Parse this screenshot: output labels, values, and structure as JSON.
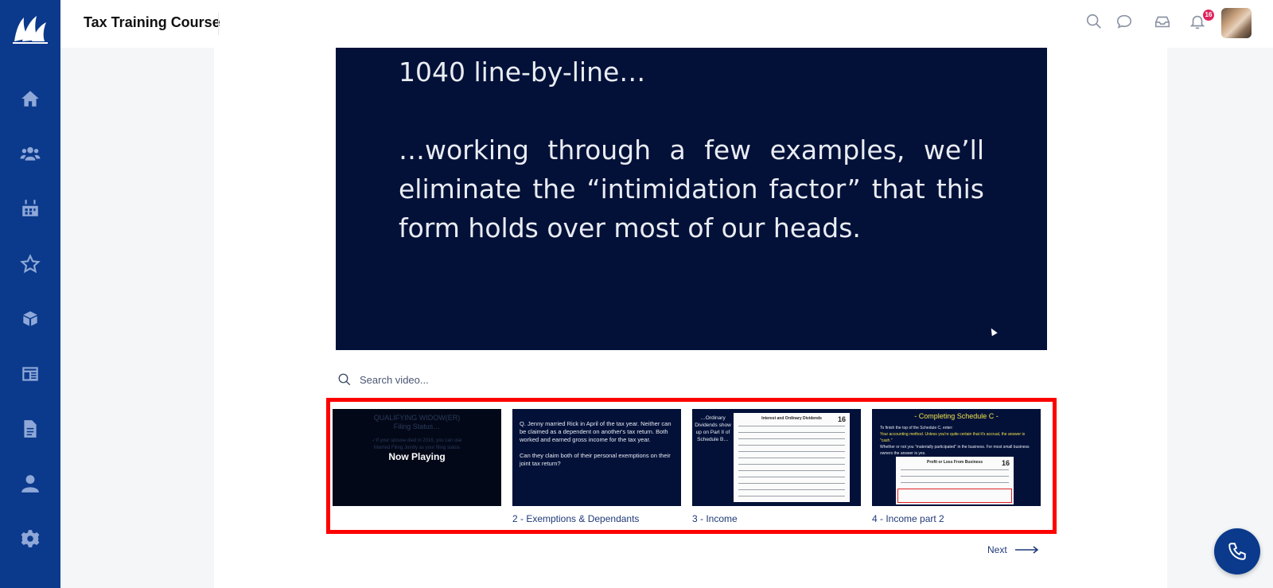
{
  "app": {
    "title": "Tax Training Course"
  },
  "header": {
    "notification_count": "16",
    "icons": [
      "search-icon",
      "chat-icon",
      "inbox-icon",
      "bell-icon",
      "avatar"
    ]
  },
  "sidebar": {
    "items": [
      {
        "icon": "home-icon"
      },
      {
        "icon": "users-icon"
      },
      {
        "icon": "calendar-icon"
      },
      {
        "icon": "star-icon"
      },
      {
        "icon": "box-icon"
      },
      {
        "icon": "newspaper-icon"
      },
      {
        "icon": "document-icon"
      },
      {
        "icon": "user-icon"
      },
      {
        "icon": "gear-icon"
      }
    ]
  },
  "video": {
    "line1": "1040 line-by-line…",
    "paragraph": "…working through a few examples, we’ll eliminate the “intimidation factor” that this form holds over most of our heads."
  },
  "search": {
    "placeholder": "Search video..."
  },
  "playlist": {
    "items": [
      {
        "label": "",
        "thumb_title_line1": "QUALIFYING WIDOW(ER)",
        "thumb_title_line2": "Filing Status…",
        "thumb_sub_line1": "✓If your spouse died in 2016, you can use",
        "thumb_sub_line2": "Married Filing Jointly as your filing status",
        "status": "Now Playing"
      },
      {
        "label": "2 - Exemptions & Dependants",
        "thumb_text": "Q. Jenny married Rick in April of the tax year. Neither can be claimed as a dependent on another's tax return. Both worked and earned gross income for the tax year.\n\nCan they claim both of their personal exemptions on their joint tax return?"
      },
      {
        "label": "3 - Income",
        "thumb_side_text": "…Ordinary Dividends show up on Part II of Schedule B…",
        "thumb_form_title": "Interest and Ordinary Dividends",
        "thumb_form_year": "16"
      },
      {
        "label": "4 - Income part 2",
        "thumb_title": "- Completing Schedule C -",
        "thumb_body_line1": "To finish the top of the Schedule C, enter:",
        "thumb_body_line2": "Your accounting method. Unless you're quite certain that it's accrual, the answer is \"cash.\"",
        "thumb_body_line3": "Whether or not you \"materially participated\" in the business. For most small business owners the answer is yes.",
        "thumb_form_title": "Profit or Loss From Business",
        "thumb_form_year": "16"
      }
    ]
  },
  "pagination": {
    "next_label": "Next"
  },
  "colors": {
    "sidebar_bg": "#0b3a8c",
    "video_bg": "#031139",
    "highlight_border": "#ff0000",
    "badge": "#e0245e",
    "link": "#1f3a78"
  }
}
